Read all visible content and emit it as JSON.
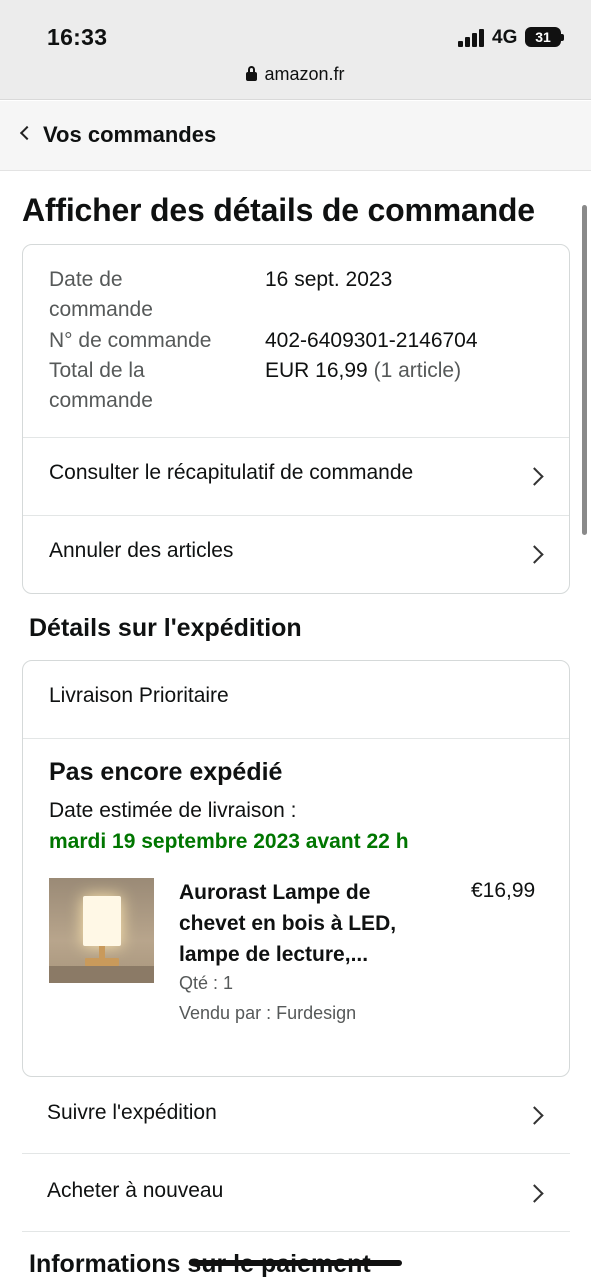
{
  "status_bar": {
    "time": "16:33",
    "network": "4G",
    "battery": "31"
  },
  "url_bar": {
    "domain": "amazon.fr"
  },
  "nav": {
    "back_label": "Vos commandes"
  },
  "page": {
    "title": "Afficher des détails de commande"
  },
  "order_info": {
    "date_label_1": "Date de",
    "date_label_2": "commande",
    "date_value": "16 sept. 2023",
    "number_label": "N° de commande",
    "number_value": "402-6409301-2146704",
    "total_label_1": "Total de la",
    "total_label_2": "commande",
    "total_value": "EUR 16,99",
    "total_count": "(1 article)",
    "summary_link": "Consulter le récapitulatif de commande",
    "cancel_link": "Annuler des articles"
  },
  "shipping": {
    "section_title": "Détails sur l'expédition",
    "type": "Livraison Prioritaire",
    "status": "Pas encore expédié",
    "estimate_label": "Date estimée de livraison :",
    "estimate_date": "mardi 19 septembre 2023 avant 22 h",
    "item": {
      "title_line1": "Aurorast Lampe de",
      "title_line2": "chevet en bois à LED,",
      "title_line3": "lampe de lecture,...",
      "price": "€16,99",
      "quantity": "Qté : 1",
      "seller": "Vendu par : Furdesign"
    },
    "track_link": "Suivre l'expédition",
    "buy_again_link": "Acheter à nouveau"
  },
  "payment": {
    "section_title": "Informations sur le paiement"
  },
  "colors": {
    "accent_green": "#007600",
    "text": "#0f1111",
    "muted": "#565959"
  }
}
